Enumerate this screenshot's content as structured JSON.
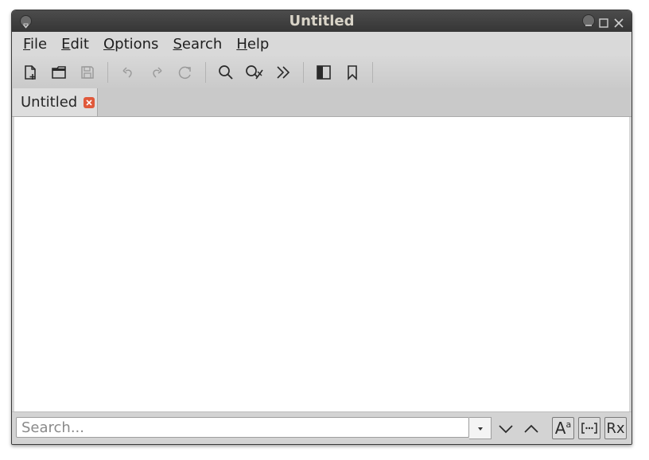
{
  "window": {
    "title": "Untitled"
  },
  "menubar": {
    "items": [
      {
        "accel": "F",
        "rest": "ile"
      },
      {
        "accel": "E",
        "rest": "dit"
      },
      {
        "accel": "O",
        "rest": "ptions"
      },
      {
        "accel": "S",
        "rest": "earch"
      },
      {
        "accel": "H",
        "rest": "elp"
      }
    ]
  },
  "toolbar": {
    "icons": [
      "new-document-icon",
      "open-folder-icon",
      "save-icon",
      "undo-icon",
      "redo-icon",
      "reload-icon",
      "find-icon",
      "replace-icon",
      "more-icon",
      "sidebar-toggle-icon",
      "bookmark-icon"
    ]
  },
  "tabs": [
    {
      "label": "Untitled"
    }
  ],
  "search": {
    "placeholder": "Search...",
    "value": "",
    "case_sensitive_label": "A",
    "case_sensitive_sup": "a",
    "regex_label": "Rx"
  },
  "colors": {
    "titlebar": "#3f3f3f",
    "title_text": "#d9d4c8",
    "tab_close": "#e0593b"
  }
}
